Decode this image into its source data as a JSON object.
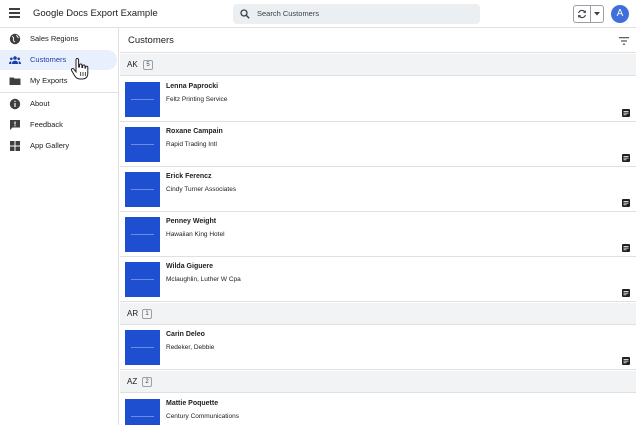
{
  "app": {
    "title": "Google Docs Export Example"
  },
  "search": {
    "placeholder": "Search Customers"
  },
  "user": {
    "avatar_initial": "A"
  },
  "sidebar": {
    "items": [
      {
        "label": "Sales Regions",
        "icon": "globe-icon"
      },
      {
        "label": "Customers",
        "icon": "people-icon",
        "active": true
      },
      {
        "label": "My Exports",
        "icon": "folder-icon"
      },
      {
        "label": "About",
        "icon": "info-icon"
      },
      {
        "label": "Feedback",
        "icon": "feedback-icon"
      },
      {
        "label": "App Gallery",
        "icon": "grid-icon"
      }
    ]
  },
  "main": {
    "title": "Customers",
    "groups": [
      {
        "label": "AK",
        "count": "5",
        "rows": [
          {
            "name": "Lenna Paprocki",
            "company": "Feltz Printing Service"
          },
          {
            "name": "Roxane Campain",
            "company": "Rapid Trading Intl"
          },
          {
            "name": "Erick Ferencz",
            "company": "Cindy Turner Associates"
          },
          {
            "name": "Penney Weight",
            "company": "Hawaiian King Hotel"
          },
          {
            "name": "Wilda Giguere",
            "company": "Mclaughlin, Luther W Cpa"
          }
        ]
      },
      {
        "label": "AR",
        "count": "1",
        "rows": [
          {
            "name": "Carin Deleo",
            "company": "Redeker, Debbie"
          }
        ]
      },
      {
        "label": "AZ",
        "count": "2",
        "rows": [
          {
            "name": "Mattie Poquette",
            "company": "Century Communications"
          }
        ]
      }
    ]
  },
  "colors": {
    "accent": "#1a3ea8",
    "thumbnail": "#1f4fd1",
    "active_nav_bg": "#e8f0fe",
    "avatar": "#3f6fd8"
  }
}
